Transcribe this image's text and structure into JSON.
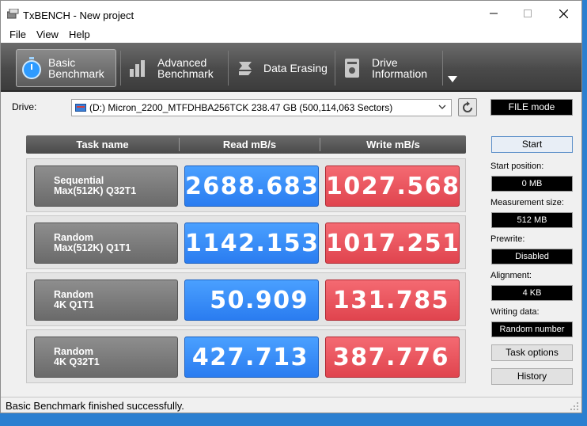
{
  "window": {
    "title": "TxBENCH - New project"
  },
  "menu": [
    "File",
    "View",
    "Help"
  ],
  "toolbar": {
    "tabs": [
      {
        "line1": "Basic",
        "line2": "Benchmark",
        "icon": "stopwatch-icon",
        "active": true
      },
      {
        "line1": "Advanced",
        "line2": "Benchmark",
        "icon": "bar-chart-icon",
        "active": false
      },
      {
        "line1": "Data Erasing",
        "line2": "",
        "icon": "eraser-icon",
        "active": false
      },
      {
        "line1": "Drive",
        "line2": "Information",
        "icon": "drive-info-icon",
        "active": false
      }
    ]
  },
  "drive": {
    "label": "Drive:",
    "selected": "(D:) Micron_2200_MTFDHBA256TCK  238.47 GB (500,114,063 Sectors)"
  },
  "mode": "FILE mode",
  "table": {
    "headers": [
      "Task name",
      "Read mB/s",
      "Write mB/s"
    ],
    "rows": [
      {
        "task1": "Sequential",
        "task2": "Max(512K) Q32T1",
        "read": "2688.683",
        "write": "1027.568"
      },
      {
        "task1": "Random",
        "task2": "Max(512K) Q1T1",
        "read": "1142.153",
        "write": "1017.251"
      },
      {
        "task1": "Random",
        "task2": "4K Q1T1",
        "read": "50.909",
        "write": "131.785"
      },
      {
        "task1": "Random",
        "task2": "4K Q32T1",
        "read": "427.713",
        "write": "387.776"
      }
    ]
  },
  "panel": {
    "start": "Start",
    "start_position_label": "Start position:",
    "start_position": "0 MB",
    "measurement_size_label": "Measurement size:",
    "measurement_size": "512 MB",
    "prewrite_label": "Prewrite:",
    "prewrite": "Disabled",
    "alignment_label": "Alignment:",
    "alignment": "4 KB",
    "writing_data_label": "Writing data:",
    "writing_data": "Random number",
    "task_options": "Task options",
    "history": "History"
  },
  "status": "Basic Benchmark finished successfully.",
  "colors": {
    "read": "#2a7cf0",
    "write": "#e0444e",
    "toolbar": "#4a4a4a"
  }
}
